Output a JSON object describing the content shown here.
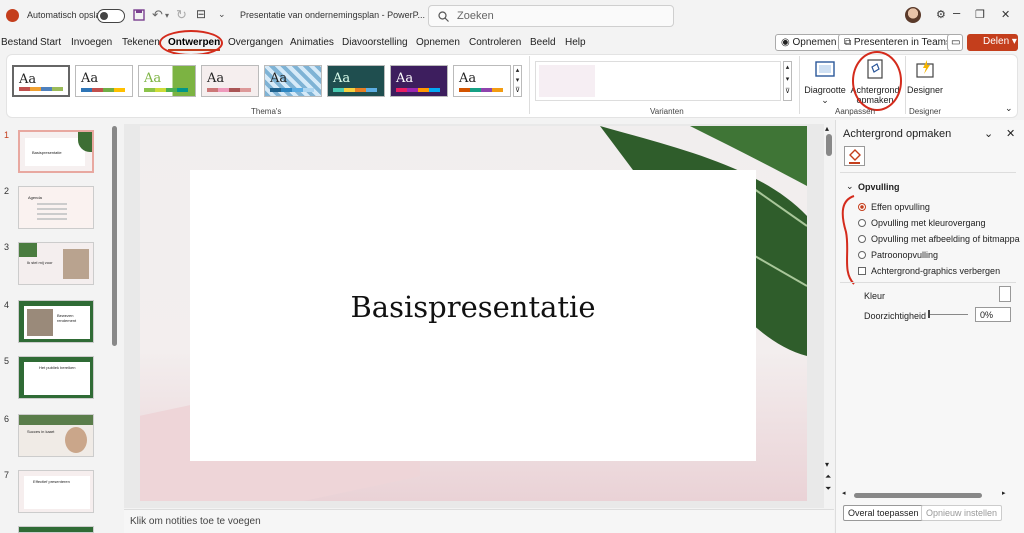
{
  "titlebar": {
    "autosave_label": "Automatisch opslaan",
    "document_title": "Presentatie van ondernemingsplan - PowerP...",
    "search_placeholder": "Zoeken"
  },
  "tabs": [
    {
      "label": "Bestand"
    },
    {
      "label": "Start"
    },
    {
      "label": "Invoegen"
    },
    {
      "label": "Tekenen"
    },
    {
      "label": "Ontwerpen",
      "active": true
    },
    {
      "label": "Overgangen"
    },
    {
      "label": "Animaties"
    },
    {
      "label": "Diavoorstelling"
    },
    {
      "label": "Opnemen"
    },
    {
      "label": "Controleren"
    },
    {
      "label": "Beeld"
    },
    {
      "label": "Help"
    }
  ],
  "header_buttons": {
    "record": "Opnemen",
    "present_teams": "Presenteren in Teams",
    "share": "Delen"
  },
  "ribbon": {
    "themes_label": "Thema's",
    "variants_label": "Varianten",
    "customize_label": "Aanpassen",
    "designer_label": "Designer",
    "slide_size": "Diagrootte",
    "format_background": "Achtergrond opmaken",
    "designer_button": "Designer",
    "theme_tile_text": "Aa"
  },
  "thumbnails": [
    {
      "num": "1",
      "selected": true,
      "text": "Basispresentatie"
    },
    {
      "num": "2",
      "text": "Agenda"
    },
    {
      "num": "3",
      "text": "Ik stel mij voor"
    },
    {
      "num": "4",
      "text": "Bewezen rendement"
    },
    {
      "num": "5",
      "text": "Het publiek bereiken"
    },
    {
      "num": "6",
      "text": "Succes in kaart"
    },
    {
      "num": "7",
      "text": "Effectief presenteren"
    }
  ],
  "slide": {
    "title": "Basispresentatie"
  },
  "notes_placeholder": "Klik om notities toe te voegen",
  "format_pane": {
    "title": "Achtergrond opmaken",
    "section": "Opvulling",
    "options": [
      {
        "label": "Effen opvulling",
        "type": "radio",
        "checked": true
      },
      {
        "label": "Opvulling met kleurovergang",
        "type": "radio"
      },
      {
        "label": "Opvulling met afbeelding of bitmappa",
        "type": "radio"
      },
      {
        "label": "Patroonopvulling",
        "type": "radio"
      },
      {
        "label": "Achtergrond-graphics verbergen",
        "type": "checkbox"
      }
    ],
    "color_label": "Kleur",
    "transparency_label": "Doorzichtigheid",
    "transparency_value": "0%",
    "apply_all": "Overal toepassen",
    "reset": "Opnieuw instellen"
  },
  "colors": {
    "accent": "#c43e1c",
    "annotation": "#d42b1c"
  }
}
